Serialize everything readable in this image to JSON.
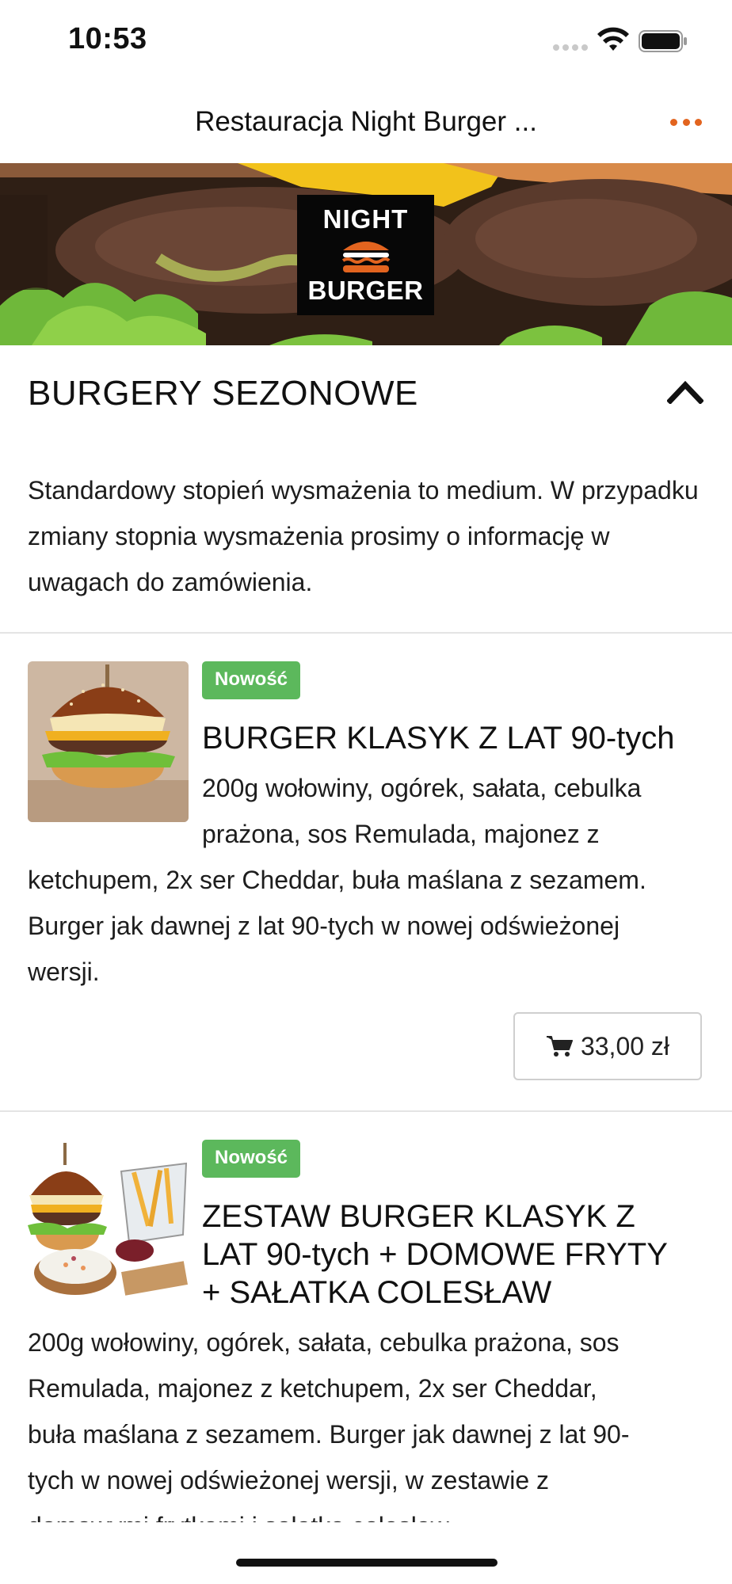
{
  "status_bar": {
    "time": "10:53"
  },
  "nav": {
    "title": "Restauracja Night Burger ..."
  },
  "hero": {
    "logo_top": "NIGHT",
    "logo_bottom": "BURGER"
  },
  "section": {
    "title": "BURGERY SEZONOWE",
    "description": "Standardowy stopień wysmażenia to medium. W przypadku zmiany stopnia wysmażenia prosimy o informację w uwagach do zamówienia."
  },
  "products": [
    {
      "badge": "Nowość",
      "title": "BURGER KLASYK Z LAT 90-tych",
      "description_lines": [
        "200g wołowiny, ogórek, sałata, cebulka",
        "prażona, sos Remulada, majonez z",
        "ketchupem, 2x ser Cheddar, buła maślana z sezamem.",
        "Burger jak dawnej z lat 90-tych w nowej odświeżonej",
        "wersji."
      ],
      "price": "33,00 zł"
    },
    {
      "badge": "Nowość",
      "title_lines": [
        "ZESTAW BURGER KLASYK Z",
        "LAT 90-tych + DOMOWE FRYTY",
        "+ SAŁATKA COLESŁAW"
      ],
      "description_lines": [
        "200g wołowiny, ogórek, sałata, cebulka prażona, sos",
        "Remulada, majonez z ketchupem, 2x ser Cheddar,",
        "buła maślana z sezamem. Burger jak dawnej z lat 90-",
        "tych w nowej odświeżonej wersji, w zestawie z",
        "domowymi frytkami i sałatką colesław"
      ]
    }
  ],
  "colors": {
    "accent": "#e2641f",
    "badge": "#5cb85c"
  },
  "icons": {
    "more": "more-icon",
    "collapse": "chevron-up-icon",
    "cart": "cart-icon"
  }
}
